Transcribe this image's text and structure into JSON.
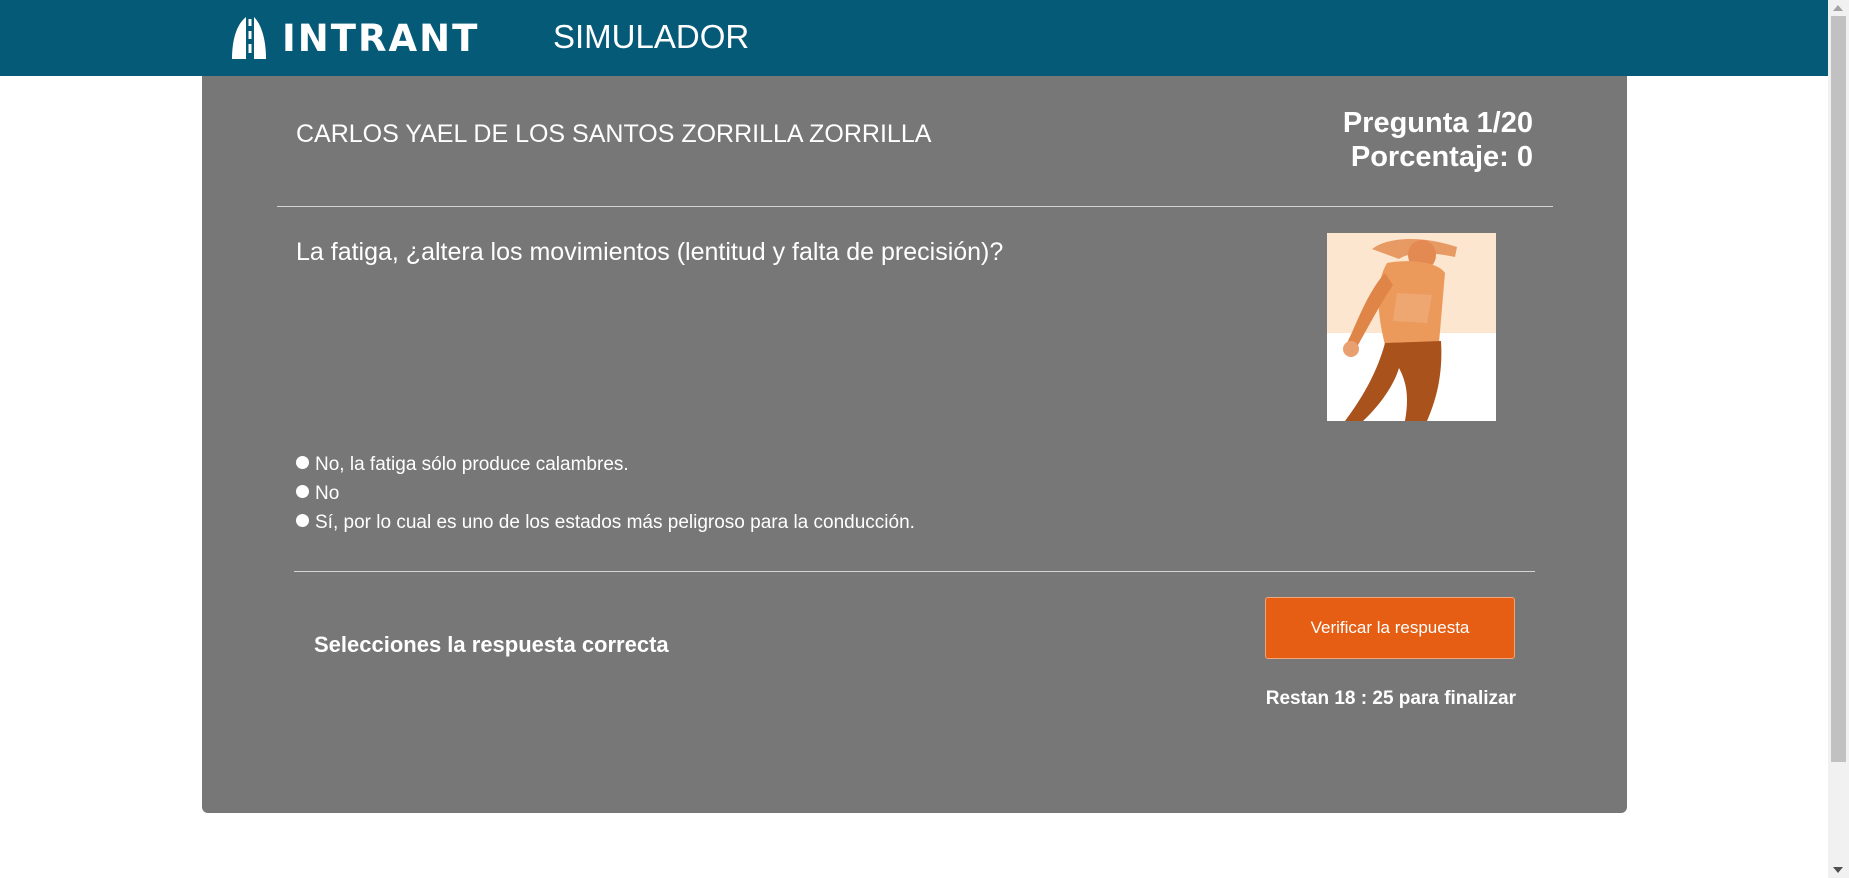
{
  "header": {
    "logo_text": "INTRANT",
    "app_title": "SIMULADOR",
    "colors": {
      "bar": "#055a78",
      "text": "#ffffff"
    }
  },
  "exam": {
    "student_name": "CARLOS YAEL DE LOS SANTOS ZORRILLA ZORRILLA",
    "question_counter": "Pregunta 1/20",
    "score": "Porcentaje: 0",
    "question_text": "La fatiga, ¿altera los movimientos (lentitud y falta de precisión)?",
    "image_icon": "fatigued-person-illustration",
    "options": [
      {
        "label": "No, la fatiga sólo produce calambres."
      },
      {
        "label": "No"
      },
      {
        "label": "Sí, por lo cual es uno de los estados más peligroso para la conducción."
      }
    ],
    "instruction": "Selecciones la respuesta correcta",
    "verify_label": "Verificar la respuesta",
    "timer_text": "Restan 18 : 25 para finalizar",
    "colors": {
      "panel": "#777777",
      "accent": "#e55e13"
    }
  }
}
